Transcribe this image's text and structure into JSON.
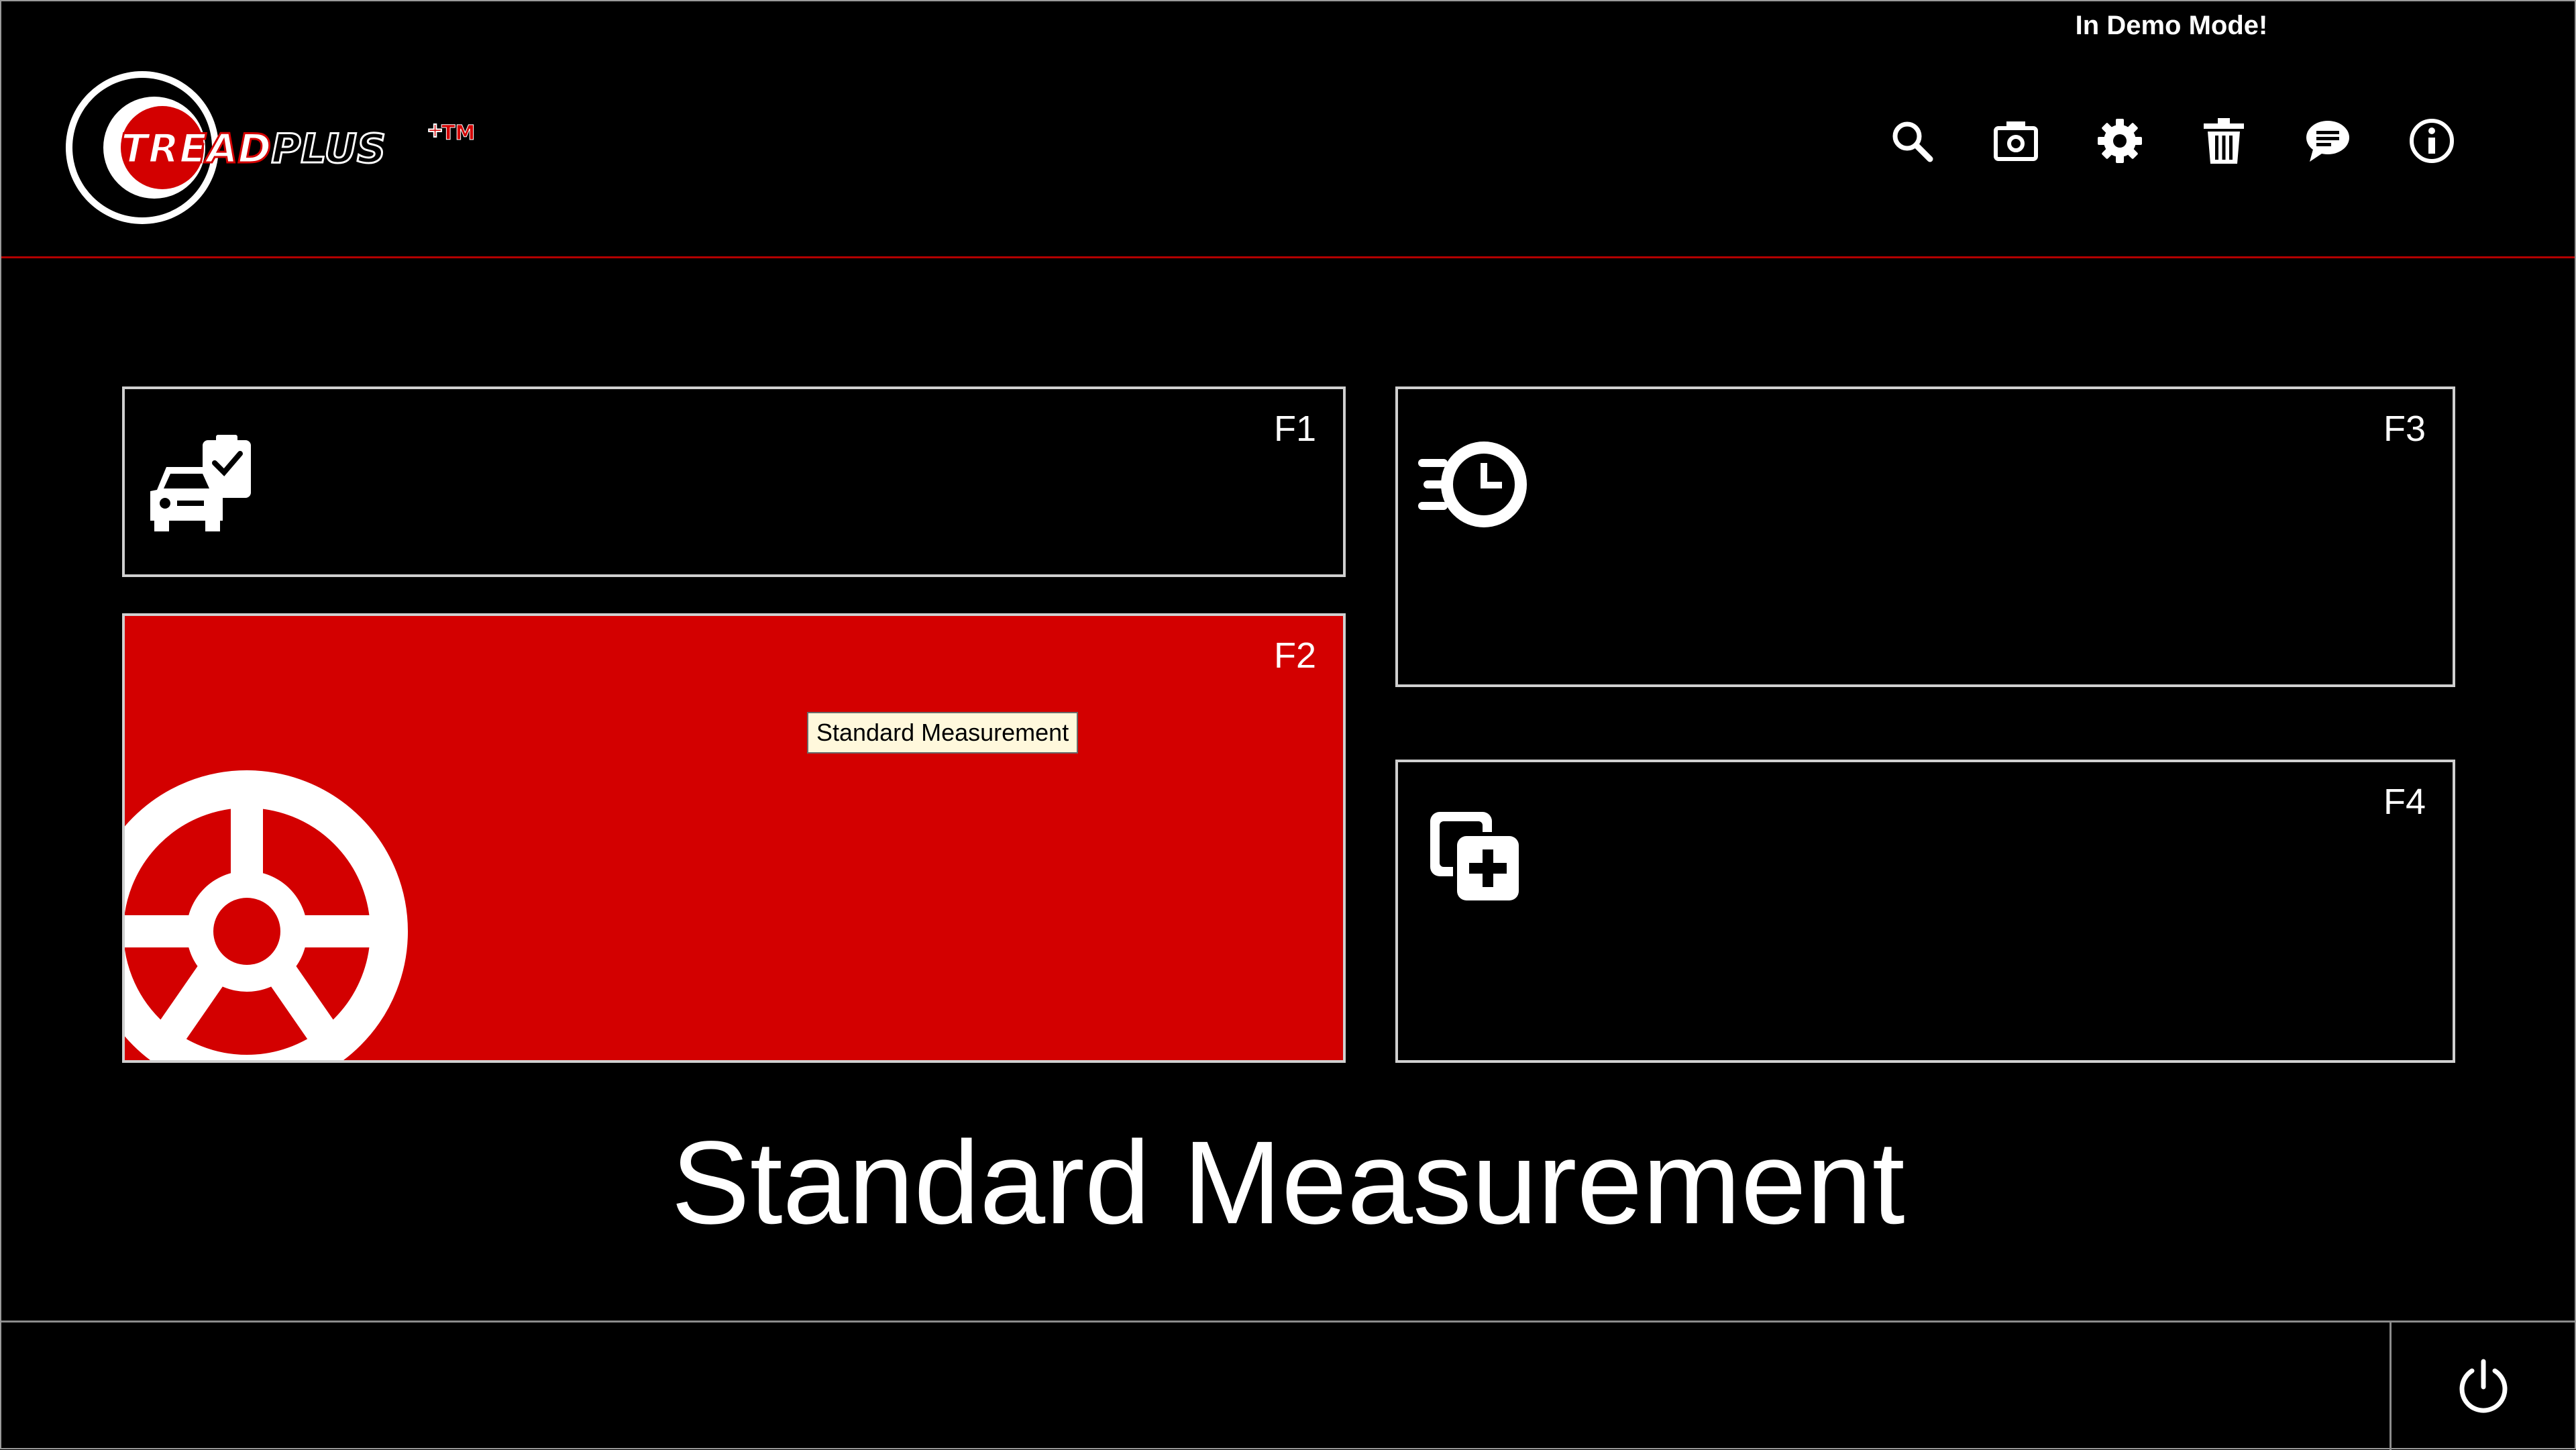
{
  "app": {
    "logo_text": "TREADPLUS",
    "logo_mark": "TM",
    "demo_notice": "In Demo Mode!"
  },
  "toolbar": {
    "buttons": [
      {
        "name": "search",
        "icon": "search-icon"
      },
      {
        "name": "camera",
        "icon": "camera-icon"
      },
      {
        "name": "settings",
        "icon": "gear-icon"
      },
      {
        "name": "delete",
        "icon": "trash-icon"
      },
      {
        "name": "messages",
        "icon": "chat-icon"
      },
      {
        "name": "info",
        "icon": "info-icon"
      }
    ]
  },
  "tiles": [
    {
      "key": "F1",
      "icon": "car-checklist-icon",
      "active": false
    },
    {
      "key": "F2",
      "icon": "wheel-icon",
      "active": true
    },
    {
      "key": "F3",
      "icon": "fast-clock-icon",
      "active": false
    },
    {
      "key": "F4",
      "icon": "add-copy-icon",
      "active": false
    }
  ],
  "tooltip": "Standard Measurement",
  "caption": "Standard Measurement",
  "footer": {
    "power_icon": "power-icon"
  },
  "colors": {
    "accent": "#d30000",
    "background": "#000000",
    "tile_border": "#d0d0d0"
  }
}
